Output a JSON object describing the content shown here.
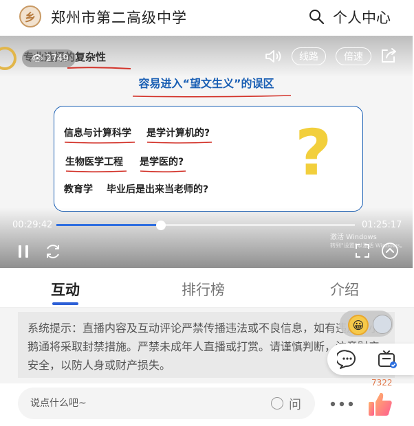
{
  "header": {
    "school_name": "郑州市第二高级中学",
    "user_center": "个人中心"
  },
  "video": {
    "slide_title": "专业选择的复杂性",
    "viewer_count": "2749",
    "route_label": "线路",
    "speed_label": "倍速",
    "slide": {
      "heading": "容易进入“望文生义”的误区",
      "rows": [
        {
          "left": "信息与计算科学",
          "right": "是学计算机的?"
        },
        {
          "left": "生物医学工程",
          "right": "是学医的?"
        },
        {
          "left": "教育学",
          "right": "毕业后是出来当老师的?"
        }
      ],
      "question_mark": "?"
    },
    "current_time": "00:29:42",
    "total_time": "01:25:17",
    "progress_fraction": 0.35,
    "watermark_line1": "激活 Windows",
    "watermark_line2": "转到\"设置\"以激活 Windows。"
  },
  "tabs": [
    {
      "label": "互动",
      "active": true
    },
    {
      "label": "排行榜",
      "active": false
    },
    {
      "label": "介绍",
      "active": false
    }
  ],
  "chat": {
    "notice": "系统提示：直播内容及互动评论严禁传播违法或不良信息，如有违反，小鹅通将采取封禁措施。严禁未成年人直播或打赏。请谨慎判断，注意财产安全，以防人身或财产损失。"
  },
  "bottom": {
    "input_placeholder": "说点什么吧~",
    "ask_label": "问",
    "like_count": "7322"
  },
  "colors": {
    "accent_blue": "#2c5fd6",
    "slide_blue": "#1a5fb4",
    "question_yellow": "#f2cf3c",
    "like_orange": "#e0784a"
  }
}
